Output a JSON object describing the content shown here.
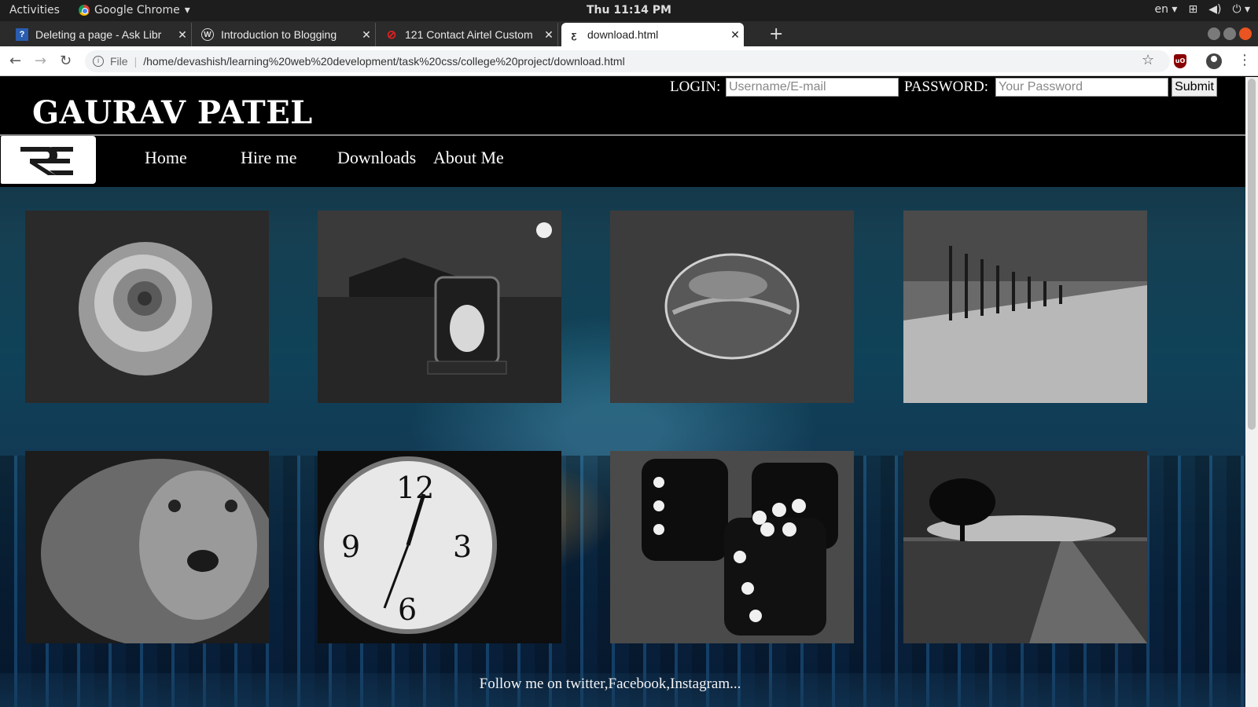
{
  "system": {
    "activities": "Activities",
    "app_name": "Google Chrome",
    "clock": "Thu 11:14 PM",
    "lang": "en"
  },
  "browser": {
    "tabs": [
      {
        "title": "Deleting a page - Ask Libr",
        "favicon": "question-icon"
      },
      {
        "title": "Introduction to Blogging",
        "favicon": "wordpress-icon"
      },
      {
        "title": "121 Contact Airtel Custom",
        "favicon": "airtel-icon"
      },
      {
        "title": "download.html",
        "favicon": "page-icon",
        "active": true
      }
    ],
    "scheme_label": "File",
    "url": "/home/devashish/learning%20web%20development/task%20css/college%20project/download.html"
  },
  "site": {
    "brand": "GAURAV PATEL",
    "login_label": "LOGIN:",
    "username_placeholder": "Username/E-mail",
    "password_label": "PASSWORD:",
    "password_placeholder": "Your Password",
    "submit_label": "Submit",
    "nav": [
      "Home",
      "Hire me",
      "Downloads",
      "About Me"
    ],
    "gallery": [
      "rose-photo",
      "lantern-photo",
      "bubble-photo",
      "trees-photo",
      "lion-photo",
      "clock-photo",
      "dice-photo",
      "lone-tree-photo"
    ],
    "footer": "Follow me on twitter,Facebook,Instagram..."
  },
  "colors": {
    "header_bg": "#000000",
    "header_text": "#ffffff",
    "os_bar": "#1d1d1d",
    "tab_strip": "#2b2b2b",
    "close_accent": "#e95420"
  }
}
